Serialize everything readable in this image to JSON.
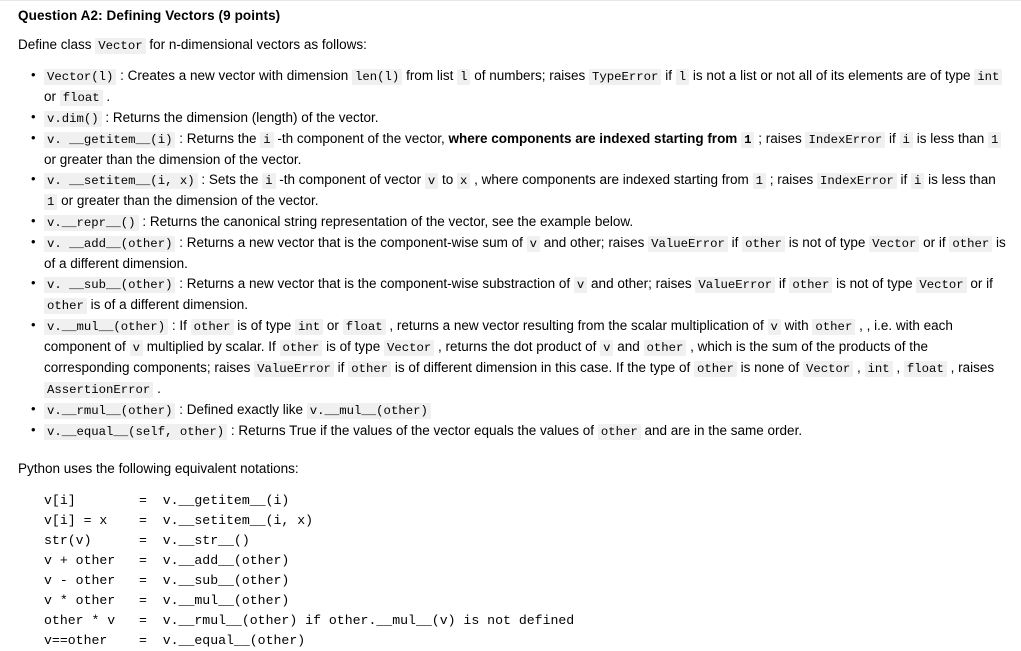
{
  "document": {
    "title": "Question A2: Defining Vectors (9 points)",
    "intro": {
      "before": "Define class ",
      "code": "Vector",
      "after": " for n-dimensional vectors as follows:"
    },
    "notations_lead": "Python uses the following equivalent notations:",
    "code_block": "v[i]        =  v.__getitem__(i)\nv[i] = x    =  v.__setitem__(i, x)\nstr(v)      =  v.__str__()\nv + other   =  v.__add__(other)\nv - other   =  v.__sub__(other)\nv * other   =  v.__mul__(other)\nother * v   =  v.__rmul__(other) if other.__mul__(v) is not defined\nv==other    =  v.__equal__(other)",
    "bullets": [
      {
        "id": "vector-constructor",
        "parts": [
          {
            "t": "code",
            "v": "Vector(l)"
          },
          {
            "t": "text",
            "v": " : Creates a new vector with dimension "
          },
          {
            "t": "code",
            "v": "len(l)"
          },
          {
            "t": "text",
            "v": " from list "
          },
          {
            "t": "code",
            "v": "l"
          },
          {
            "t": "text",
            "v": " of numbers; raises "
          },
          {
            "t": "code",
            "v": "TypeError"
          },
          {
            "t": "text",
            "v": " if "
          },
          {
            "t": "code",
            "v": "l"
          },
          {
            "t": "text",
            "v": " is not a list or not all of its elements are of type "
          },
          {
            "t": "code",
            "v": "int"
          },
          {
            "t": "text",
            "v": " or "
          },
          {
            "t": "code",
            "v": "float"
          },
          {
            "t": "text",
            "v": " ."
          }
        ]
      },
      {
        "id": "vector-dim",
        "parts": [
          {
            "t": "code",
            "v": "v.dim()"
          },
          {
            "t": "text",
            "v": " : Returns the dimension (length) of the vector."
          }
        ]
      },
      {
        "id": "vector-getitem",
        "parts": [
          {
            "t": "code",
            "v": "v. __getitem__(i)"
          },
          {
            "t": "text",
            "v": " : Returns the "
          },
          {
            "t": "code",
            "v": "i"
          },
          {
            "t": "text",
            "v": " -th component of the vector, "
          },
          {
            "t": "bold",
            "v": "where components are indexed starting from "
          },
          {
            "t": "boldcode",
            "v": "1"
          },
          {
            "t": "text",
            "v": " ; raises "
          },
          {
            "t": "code",
            "v": "IndexError"
          },
          {
            "t": "text",
            "v": " if "
          },
          {
            "t": "code",
            "v": "i"
          },
          {
            "t": "text",
            "v": " is less than "
          },
          {
            "t": "code",
            "v": "1"
          },
          {
            "t": "text",
            "v": " or greater than the dimension of the vector."
          }
        ]
      },
      {
        "id": "vector-setitem",
        "parts": [
          {
            "t": "code",
            "v": "v. __setitem__(i, x)"
          },
          {
            "t": "text",
            "v": " : Sets the "
          },
          {
            "t": "code",
            "v": "i"
          },
          {
            "t": "text",
            "v": " -th component of vector "
          },
          {
            "t": "code",
            "v": "v"
          },
          {
            "t": "text",
            "v": " to "
          },
          {
            "t": "code",
            "v": "x"
          },
          {
            "t": "text",
            "v": " , where components are indexed starting from "
          },
          {
            "t": "code",
            "v": "1"
          },
          {
            "t": "text",
            "v": " ; raises "
          },
          {
            "t": "code",
            "v": "IndexError"
          },
          {
            "t": "text",
            "v": " if "
          },
          {
            "t": "code",
            "v": "i"
          },
          {
            "t": "text",
            "v": " is less than "
          },
          {
            "t": "code",
            "v": "1"
          },
          {
            "t": "text",
            "v": " or greater than the dimension of the vector."
          }
        ]
      },
      {
        "id": "vector-repr",
        "parts": [
          {
            "t": "code",
            "v": "v.__repr__()"
          },
          {
            "t": "text",
            "v": " : Returns the canonical string representation of the vector, see the example below."
          }
        ]
      },
      {
        "id": "vector-add",
        "parts": [
          {
            "t": "code",
            "v": "v. __add__(other)"
          },
          {
            "t": "text",
            "v": " : Returns a new vector that is the component-wise sum of "
          },
          {
            "t": "code",
            "v": "v"
          },
          {
            "t": "text",
            "v": " and other; raises "
          },
          {
            "t": "code",
            "v": "ValueError"
          },
          {
            "t": "text",
            "v": " if "
          },
          {
            "t": "code",
            "v": "other"
          },
          {
            "t": "text",
            "v": " is not of type "
          },
          {
            "t": "code",
            "v": "Vector"
          },
          {
            "t": "text",
            "v": " or if "
          },
          {
            "t": "code",
            "v": "other"
          },
          {
            "t": "text",
            "v": " is of a different dimension."
          }
        ]
      },
      {
        "id": "vector-sub",
        "parts": [
          {
            "t": "code",
            "v": "v. __sub__(other)"
          },
          {
            "t": "text",
            "v": " : Returns a new vector that is the component-wise substraction of "
          },
          {
            "t": "code",
            "v": "v"
          },
          {
            "t": "text",
            "v": " and other; raises "
          },
          {
            "t": "code",
            "v": "ValueError"
          },
          {
            "t": "text",
            "v": " if "
          },
          {
            "t": "code",
            "v": "other"
          },
          {
            "t": "text",
            "v": " is not of type "
          },
          {
            "t": "code",
            "v": "Vector"
          },
          {
            "t": "text",
            "v": " or if "
          },
          {
            "t": "code",
            "v": "other"
          },
          {
            "t": "text",
            "v": " is of a different dimension."
          }
        ]
      },
      {
        "id": "vector-mul",
        "parts": [
          {
            "t": "code",
            "v": "v.__mul__(other)"
          },
          {
            "t": "text",
            "v": " : If "
          },
          {
            "t": "code",
            "v": "other"
          },
          {
            "t": "text",
            "v": " is of type "
          },
          {
            "t": "code",
            "v": "int"
          },
          {
            "t": "text",
            "v": " or "
          },
          {
            "t": "code",
            "v": "float"
          },
          {
            "t": "text",
            "v": " , returns a new vector resulting from the scalar multiplication of "
          },
          {
            "t": "code",
            "v": "v"
          },
          {
            "t": "text",
            "v": " with "
          },
          {
            "t": "code",
            "v": "other"
          },
          {
            "t": "text",
            "v": " , , i.e. with each component of "
          },
          {
            "t": "code",
            "v": "v"
          },
          {
            "t": "text",
            "v": " multiplied by scalar. If "
          },
          {
            "t": "code",
            "v": "other"
          },
          {
            "t": "text",
            "v": " is of type "
          },
          {
            "t": "code",
            "v": "Vector"
          },
          {
            "t": "text",
            "v": " , returns the dot product of "
          },
          {
            "t": "code",
            "v": "v"
          },
          {
            "t": "text",
            "v": " and "
          },
          {
            "t": "code",
            "v": "other"
          },
          {
            "t": "text",
            "v": " , which is the sum of the products of the corresponding components; raises "
          },
          {
            "t": "code",
            "v": "ValueError"
          },
          {
            "t": "text",
            "v": " if "
          },
          {
            "t": "code",
            "v": "other"
          },
          {
            "t": "text",
            "v": " is of different dimension in this case. If the type of "
          },
          {
            "t": "code",
            "v": "other"
          },
          {
            "t": "text",
            "v": " is none of "
          },
          {
            "t": "code",
            "v": "Vector"
          },
          {
            "t": "text",
            "v": " , "
          },
          {
            "t": "code",
            "v": "int"
          },
          {
            "t": "text",
            "v": " , "
          },
          {
            "t": "code",
            "v": "float"
          },
          {
            "t": "text",
            "v": " , raises "
          },
          {
            "t": "code",
            "v": "AssertionError"
          },
          {
            "t": "text",
            "v": " ."
          }
        ]
      },
      {
        "id": "vector-rmul",
        "parts": [
          {
            "t": "code",
            "v": "v.__rmul__(other)"
          },
          {
            "t": "text",
            "v": " : Defined exactly like "
          },
          {
            "t": "code",
            "v": "v.__mul__(other)"
          }
        ]
      },
      {
        "id": "vector-equal",
        "parts": [
          {
            "t": "code",
            "v": "v.__equal__(self, other)"
          },
          {
            "t": "text",
            "v": " : Returns True if the values of the vector equals the values of "
          },
          {
            "t": "code",
            "v": "other"
          },
          {
            "t": "text",
            "v": " and are in the same order."
          }
        ]
      }
    ]
  }
}
